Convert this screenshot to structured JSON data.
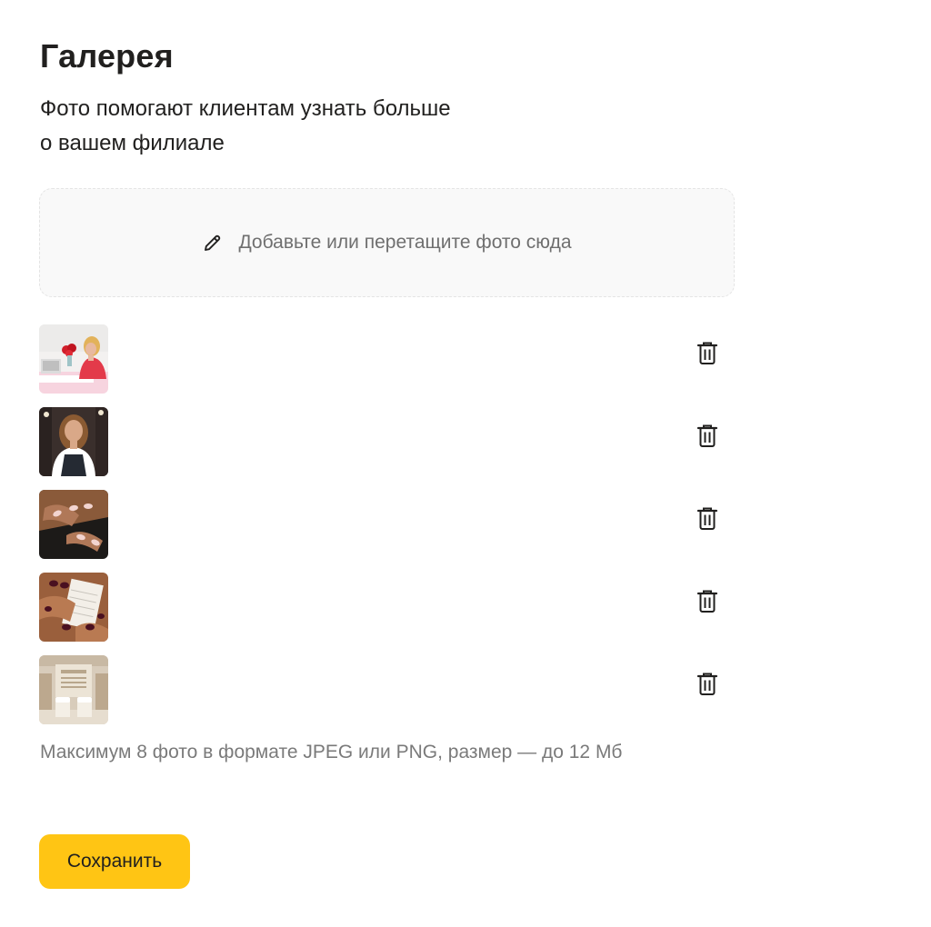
{
  "gallery": {
    "title": "Галерея",
    "subtitle_line1": "Фото помогают клиентам узнать больше",
    "subtitle_line2": "о вашем филиале"
  },
  "dropzone": {
    "label": "Добавьте или перетащите фото сюда",
    "icon": "pencil-icon"
  },
  "photos": [
    {
      "subject": "woman at desk with roses",
      "action_icon": "trash-icon"
    },
    {
      "subject": "woman in apron portrait",
      "action_icon": "trash-icon"
    },
    {
      "subject": "pale pink manicure",
      "action_icon": "trash-icon"
    },
    {
      "subject": "dark burgundy manicure",
      "action_icon": "trash-icon"
    },
    {
      "subject": "salon interior",
      "action_icon": "trash-icon"
    }
  ],
  "note": "Максимум 8 фото в формате JPEG или PNG, размер — до 12 Мб",
  "actions": {
    "save_label": "Сохранить"
  },
  "colors": {
    "accent": "#ffc514",
    "text": "#21201f",
    "muted": "#7a7a7a",
    "dropzone_bg": "#f9f9f9"
  }
}
